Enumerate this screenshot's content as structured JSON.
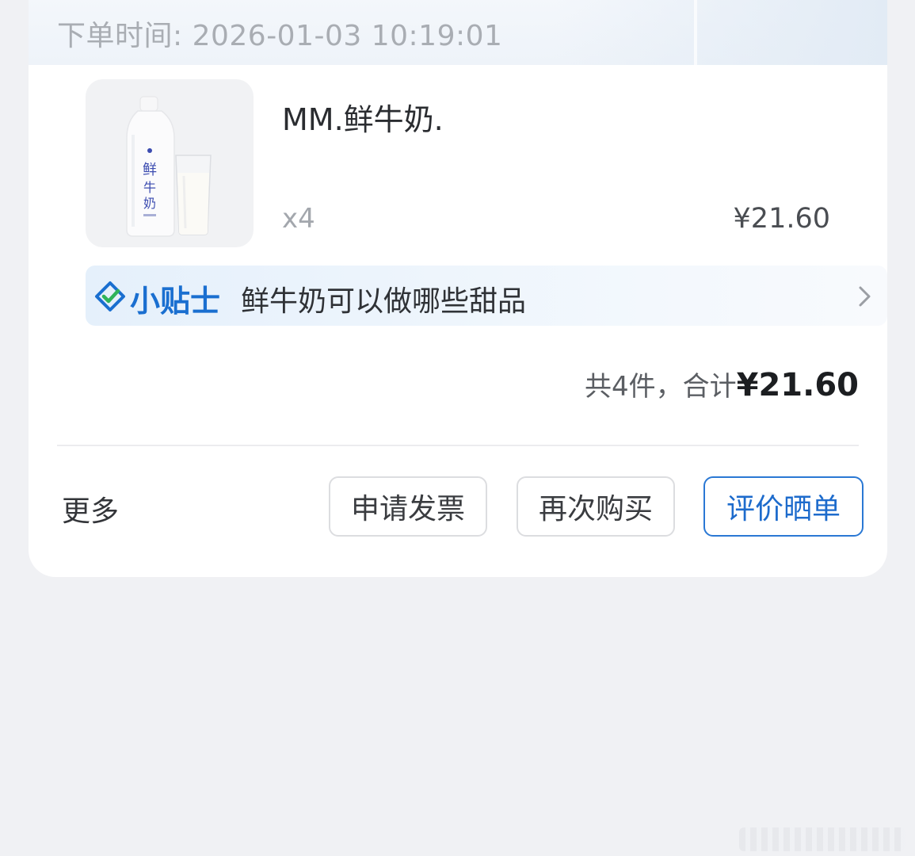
{
  "order": {
    "time_label": "下单时间: 2026-01-03 10:19:01"
  },
  "product": {
    "name": "MM.鲜牛奶.",
    "quantity": "x4",
    "price": "¥21.60",
    "image": "fresh-milk-bottle-and-glass",
    "label_text": "鲜牛奶"
  },
  "tip": {
    "title": "小贴士",
    "text": "鲜牛奶可以做哪些甜品"
  },
  "summary": {
    "text": "共4件，合计",
    "total": "¥21.60"
  },
  "actions": {
    "more": "更多",
    "invoice": "申请发票",
    "rebuy": "再次购买",
    "review": "评价晒单"
  },
  "colors": {
    "accent": "#1d6bcc",
    "page_bg": "#f0f1f4",
    "card_bg": "#ffffff"
  }
}
